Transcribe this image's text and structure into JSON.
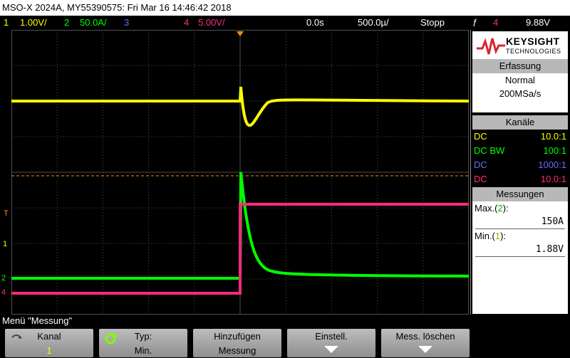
{
  "title": "MSO-X 2024A, MY55390575: Fri Mar 16 14:46:42 2018",
  "status": {
    "ch1_num": "1",
    "ch1_scale": "1.00V/",
    "ch2_num": "2",
    "ch2_scale": "50.0A/",
    "ch3_num": "3",
    "ch4_num": "4",
    "ch4_scale": "5.00V/",
    "delay": "0.0s",
    "timebase": "500.0µ/",
    "run_state": "Stopp",
    "trigger_source": "4",
    "trigger_level": "9.88V"
  },
  "logo": {
    "brand": "KEYSIGHT",
    "sub": "TECHNOLOGIES"
  },
  "acquisition": {
    "header": "Erfassung",
    "mode": "Normal",
    "rate": "200MSa/s"
  },
  "channels": {
    "header": "Kanäle",
    "rows": [
      {
        "coupling": "DC",
        "probe": "10.0:1",
        "color": "#ffff00"
      },
      {
        "coupling": "DC BW",
        "probe": "100:1",
        "color": "#00ff00"
      },
      {
        "coupling": "DC",
        "probe": "1000:1",
        "color": "#5f6fff"
      },
      {
        "coupling": "DC",
        "probe": "10.0:1",
        "color": "#ff2a7f"
      }
    ]
  },
  "measurements": {
    "header": "Messungen",
    "items": [
      {
        "label_pre": "Max.(",
        "label_ch": "2",
        "label_post": "):",
        "value": "150A",
        "ch_color": "#00aa00"
      },
      {
        "label_pre": "Min.(",
        "label_ch": "1",
        "label_post": "):",
        "value": "1.88V",
        "ch_color": "#aaaa00"
      }
    ]
  },
  "markers": {
    "trigger": "T",
    "ch1": "1",
    "ch2": "2",
    "ch4": "4"
  },
  "menu_label": "Menü \"Messung\"",
  "softkeys": [
    {
      "line1": "Kanal",
      "line2": "1"
    },
    {
      "line1": "Typ:",
      "line2": "Min."
    },
    {
      "line1": "Hinzufügen",
      "line2": "Messung"
    },
    {
      "line1": "Einstell.",
      "line2": ""
    },
    {
      "line1": "Mess. löschen",
      "line2": ""
    }
  ],
  "colors": {
    "ch1": "#ffff00",
    "ch2": "#00ff00",
    "ch3": "#5f6fff",
    "ch4": "#ff2a7f",
    "trigger": "#ff8c00",
    "grid": "#505050"
  }
}
